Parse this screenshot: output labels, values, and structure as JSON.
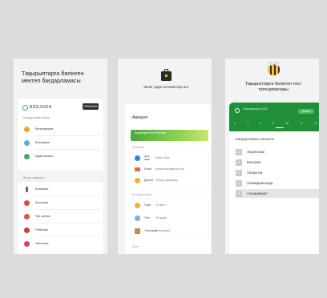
{
  "screen1": {
    "title": "Тақырыптарға бөлінген мектеп бағдарламасы",
    "logo_text": "BIOLOGIA",
    "premium_badge": "PREMIUM",
    "section1_caption": "Бағдарлама кезеңі",
    "section1_items": [
      {
        "label": "Вегетариана",
        "icon": "leaf-icon",
        "color": "#e7a72c"
      },
      {
        "label": "Биосфера",
        "icon": "globe-icon",
        "color": "#6fa8d8"
      },
      {
        "label": "Адам ағзасы",
        "icon": "person-icon",
        "color": "#4aa66a"
      }
    ],
    "section2_caption": "Жаңа тақырып",
    "section2_items": [
      {
        "label": "Ботаника",
        "icon": "plant-icon",
        "color": "#8a5a3b"
      },
      {
        "label": "Зоология",
        "icon": "animal-icon",
        "color": "#d14f3d"
      },
      {
        "label": "Тірі клетка",
        "icon": "cell-icon",
        "color": "#e4533b"
      },
      {
        "label": "Генетика",
        "icon": "dna-icon",
        "color": "#c83a3a"
      },
      {
        "label": "Экология",
        "icon": "eco-icon",
        "color": "#d64560"
      }
    ]
  },
  "screen2": {
    "headline": "Жеке үздік нәтижесіңіз ал!",
    "panel_title": "Аккаунт",
    "banner_text": "Қолжетімсіз тест Premium",
    "caption_profile": "Профиль",
    "profile_rows": [
      {
        "key": "Аты-жөні",
        "value": "Aruna Zhan",
        "icon": "user-icon",
        "color": "#3b7fd3"
      },
      {
        "key": "Email",
        "value": "aruna.zhan@gmail.com",
        "icon": "mail-icon",
        "color": "#e66a3b"
      },
      {
        "key": "Деңгей",
        "value": "Топтық оқушылар",
        "icon": "level-icon",
        "color": "#f0b13a"
      }
    ],
    "caption_stats": "Ең үздік нәтиже",
    "stat_rows": [
      {
        "key": "Ұпай",
        "value": "20 балл",
        "icon": "trophy-icon",
        "color": "#e8b13a"
      },
      {
        "key": "Тест",
        "value": "40 сұрақ",
        "icon": "clock-icon",
        "color": "#7fb0d8"
      },
      {
        "key": "Тапсырма",
        "value": "Белсенділік",
        "icon": "chart-icon",
        "color": "#c08a5a"
      }
    ],
    "caption_more": "Шығу"
  },
  "screen3": {
    "title": "Тақырыптарға бөлінген тест тапсырмалары",
    "green_text": "Тапсырмалар 10/20",
    "pill_label": "Келесі",
    "numbers": [
      "6",
      "7",
      "8",
      "9",
      "10",
      "11",
      "12"
    ],
    "active_number": "10",
    "caption": "Бағдарламаны жалғасы",
    "options": [
      {
        "letter": "A",
        "text": "Эндоплазм"
      },
      {
        "letter": "B",
        "text": "Вольвокс"
      },
      {
        "letter": "C",
        "text": "Хлорелла"
      },
      {
        "letter": "D",
        "text": "Хламидомонада"
      },
      {
        "letter": "E",
        "text": "Сахаромицет"
      }
    ],
    "selected_index": 4
  }
}
